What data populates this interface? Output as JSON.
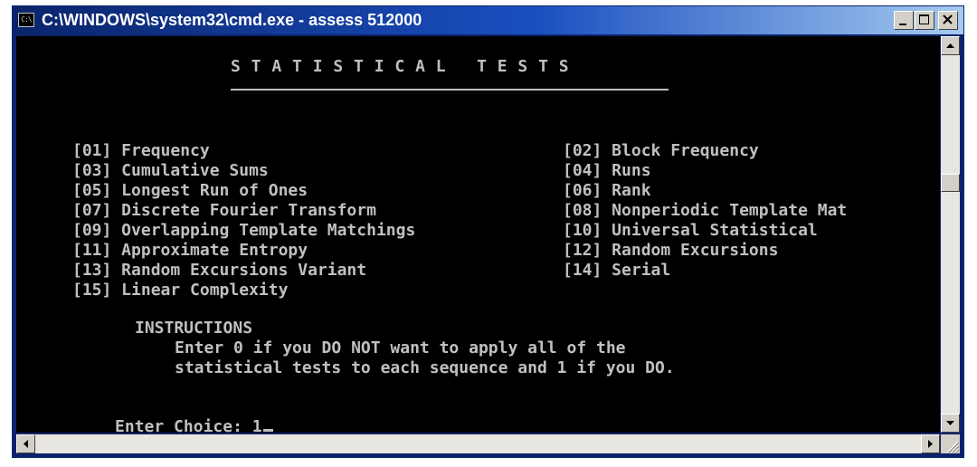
{
  "window": {
    "title": "C:\\WINDOWS\\system32\\cmd.exe - assess 512000",
    "system_icon_text": "C:\\"
  },
  "console": {
    "heading": "S T A T I S T I C A L   T E S T S",
    "tests_left": [
      "[01] Frequency",
      "[03] Cumulative Sums",
      "[05] Longest Run of Ones",
      "[07] Discrete Fourier Transform",
      "[09] Overlapping Template Matchings",
      "[11] Approximate Entropy",
      "[13] Random Excursions Variant",
      "[15] Linear Complexity"
    ],
    "tests_right": [
      "[02] Block Frequency",
      "[04] Runs",
      "[06] Rank",
      "[08] Nonperiodic Template Mat",
      "[10] Universal Statistical",
      "[12] Random Excursions",
      "[14] Serial"
    ],
    "instructions_title": "INSTRUCTIONS",
    "instructions_line1": "Enter 0 if you DO NOT want to apply all of the",
    "instructions_line2": "statistical tests to each sequence and 1 if you DO.",
    "prompt": "Enter Choice: 1"
  },
  "colors": {
    "console_bg": "#000000",
    "console_text": "#c0c0c0",
    "titlebar_start": "#0a246a",
    "titlebar_end": "#a6caf0"
  },
  "icons": {
    "system": "cmd-icon",
    "minimize": "minimize-icon",
    "maximize": "maximize-icon",
    "close": "close-icon"
  }
}
